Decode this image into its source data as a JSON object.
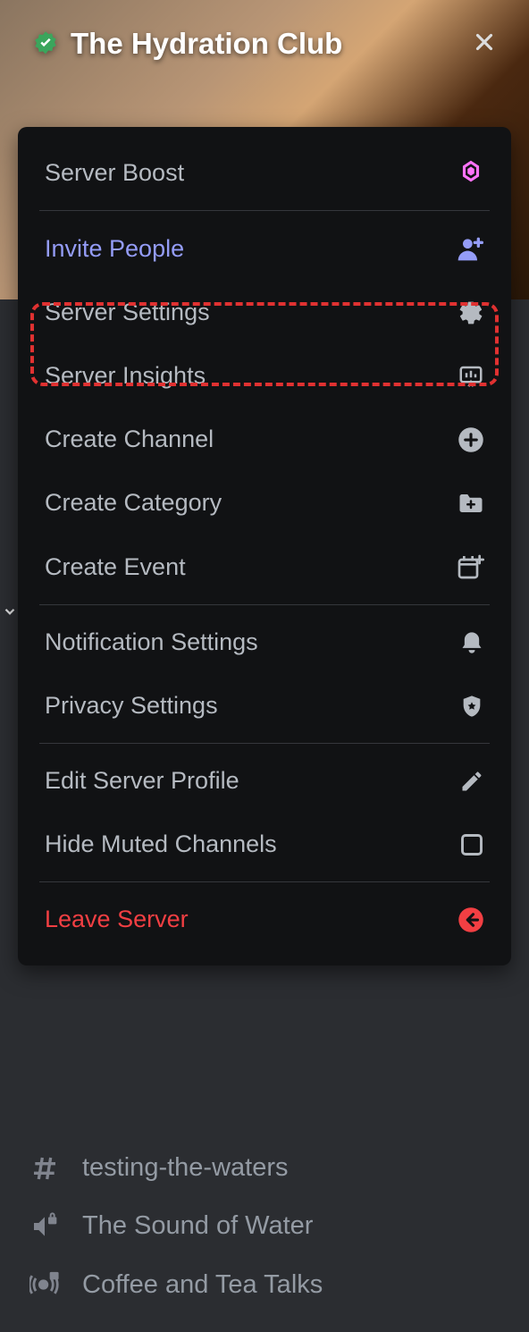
{
  "header": {
    "server_name": "The Hydration Club"
  },
  "menu": {
    "server_boost": "Server Boost",
    "invite_people": "Invite People",
    "server_settings": "Server Settings",
    "server_insights": "Server Insights",
    "create_channel": "Create Channel",
    "create_category": "Create Category",
    "create_event": "Create Event",
    "notification_settings": "Notification Settings",
    "privacy_settings": "Privacy Settings",
    "edit_server_profile": "Edit Server Profile",
    "hide_muted_channels": "Hide Muted Channels",
    "leave_server": "Leave Server"
  },
  "channels": {
    "testing": "testing-the-waters",
    "sound": "The Sound of Water",
    "coffee": "Coffee and Tea Talks"
  }
}
